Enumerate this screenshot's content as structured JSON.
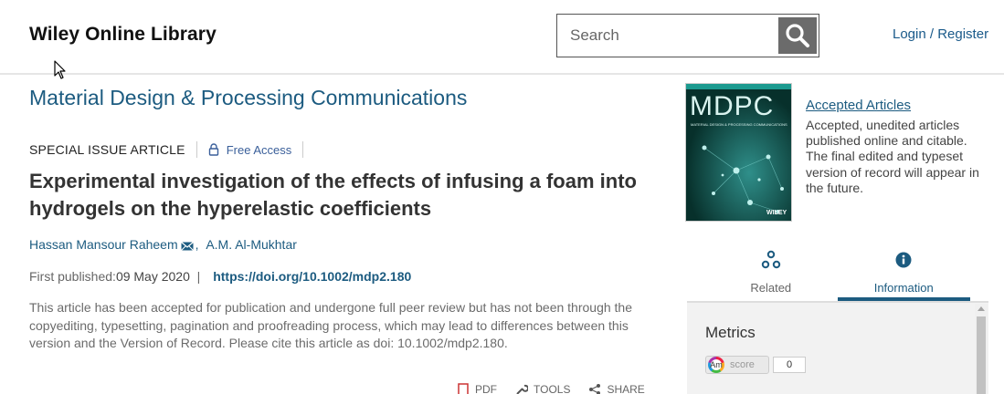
{
  "header": {
    "logo": "Wiley Online Library",
    "search_placeholder": "Search",
    "login_label": "Login / Register"
  },
  "journal": {
    "title": "Material Design & Processing Communications"
  },
  "article": {
    "type": "SPECIAL ISSUE ARTICLE",
    "access": "Free Access",
    "title": "Experimental investigation of the effects of infusing a foam into hydrogels on the hyperelastic coefficients",
    "authors": [
      "Hassan Mansour Raheem",
      "A.M. Al-Mukhtar"
    ],
    "first_published_label": "First published:",
    "first_published_date": "09 May 2020",
    "doi": "https://doi.org/10.1002/mdp2.180",
    "notice": "This article has been accepted for publication and undergone full peer review but has not been through the copyediting, typesetting, pagination and proofreading process, which may lead to differences between this version and the Version of Record. Please cite this article as doi: 10.1002/mdp2.180."
  },
  "tools": {
    "pdf": "PDF",
    "tools": "TOOLS",
    "share": "SHARE"
  },
  "sidebar": {
    "cover_title": "MDPC",
    "cover_subtitle": "MATERIAL DESIGN & PROCESSING COMMUNICATIONS",
    "cover_publisher": "WILEY",
    "accepted_link": "Accepted Articles",
    "accepted_desc": "Accepted, unedited articles published online and citable. The final edited and typeset version of record will appear in the future.",
    "tabs": [
      {
        "label": "Related",
        "icon": "related-icon"
      },
      {
        "label": "Information",
        "icon": "info-icon"
      }
    ],
    "metrics_title": "Metrics",
    "altmetric_label": "score",
    "altmetric_count": "0"
  },
  "colors": {
    "link": "#1c5b80",
    "search_button": "#6b6b6b"
  }
}
